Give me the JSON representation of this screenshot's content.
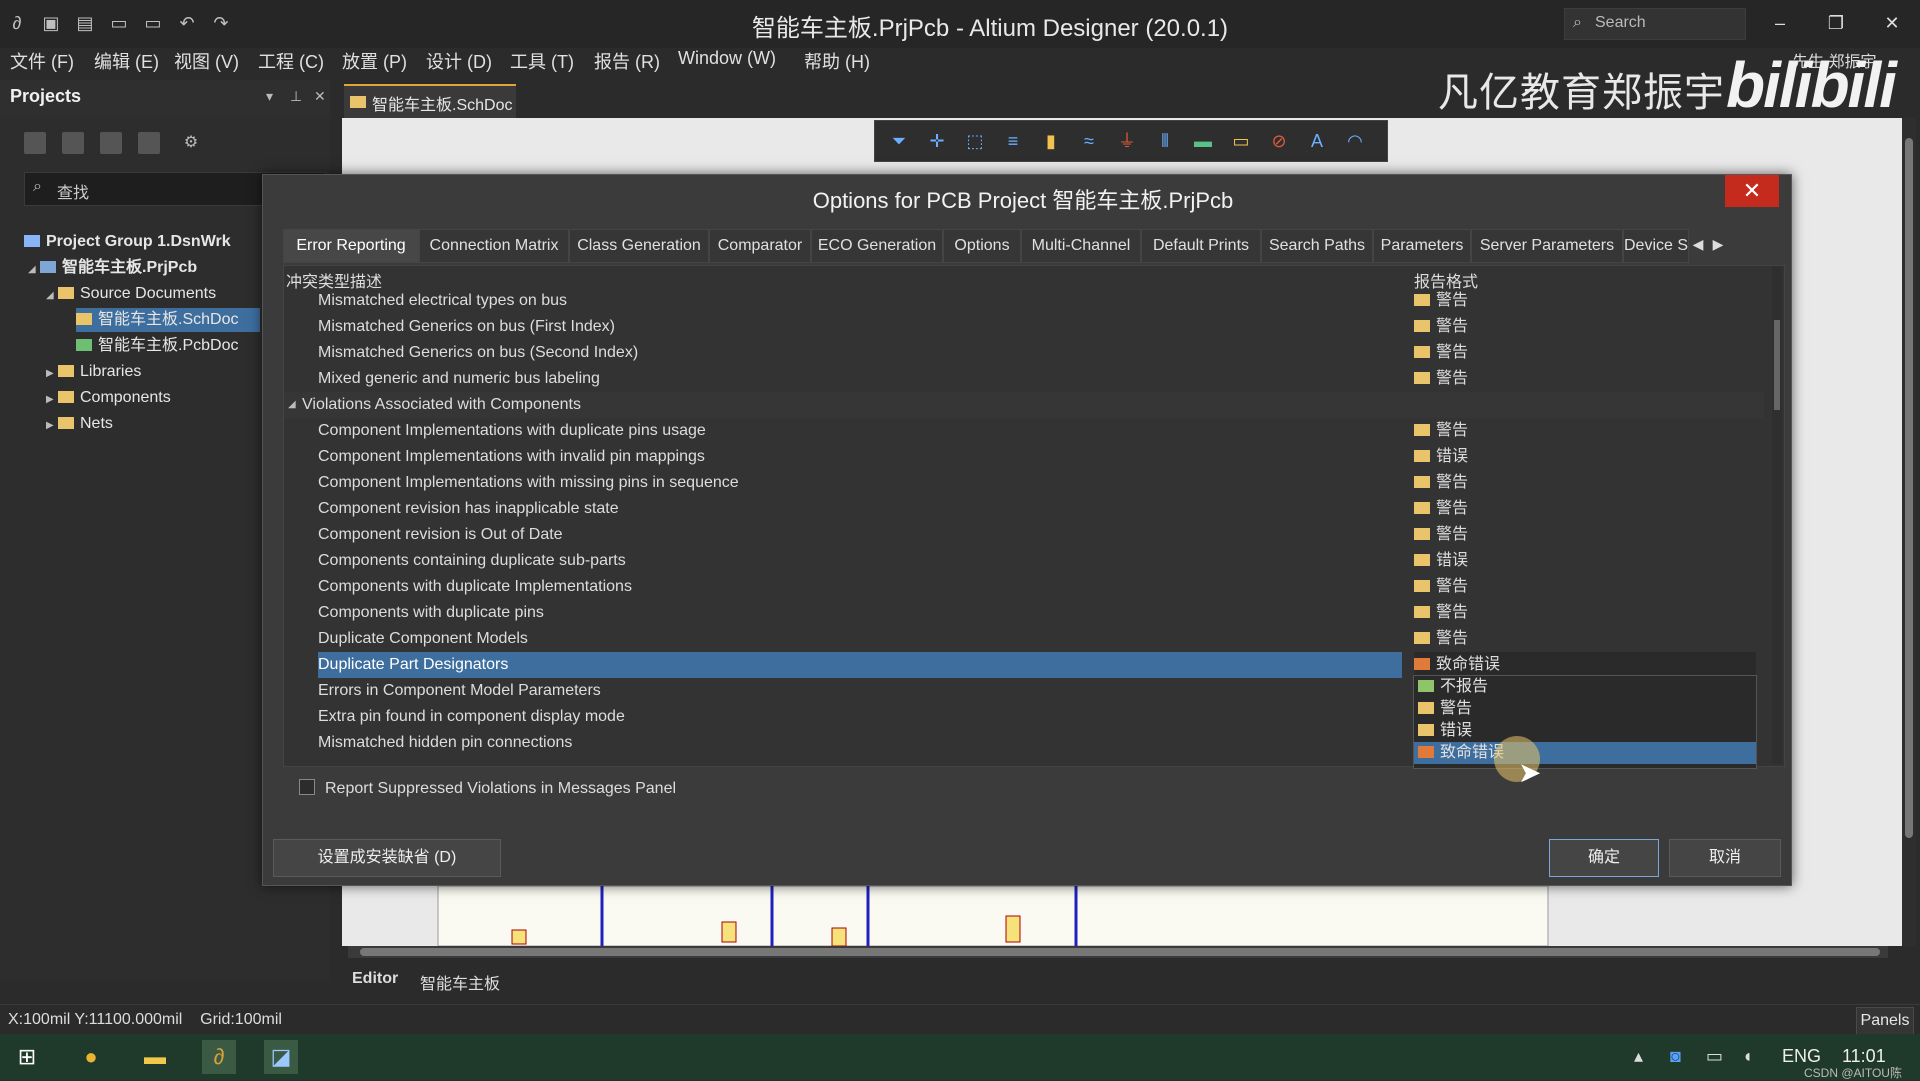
{
  "window": {
    "title": "智能车主板.PrjPcb - Altium Designer (20.0.1)",
    "search_placeholder": "Search",
    "user_label": "先生 郑振宇"
  },
  "menu": [
    "文件 (F)",
    "编辑 (E)",
    "视图 (V)",
    "工程 (C)",
    "放置 (P)",
    "设计 (D)",
    "工具 (T)",
    "报告 (R)",
    "Window (W)",
    "帮助 (H)"
  ],
  "branding": {
    "text": "凡亿教育郑振宇",
    "bili": "bilibili"
  },
  "projects": {
    "title": "Projects",
    "search_placeholder": "查找",
    "tree": [
      {
        "label": "Project Group 1.DsnWrk"
      },
      {
        "label": "智能车主板.PrjPcb"
      },
      {
        "label": "Source Documents"
      },
      {
        "label": "智能车主板.SchDoc"
      },
      {
        "label": "智能车主板.PcbDoc"
      },
      {
        "label": "Libraries"
      },
      {
        "label": "Components"
      },
      {
        "label": "Nets"
      }
    ]
  },
  "doc_tab": "智能车主板.SchDoc",
  "dialog": {
    "title": "Options for PCB Project 智能车主板.PrjPcb",
    "tabs": [
      "Error Reporting",
      "Connection Matrix",
      "Class Generation",
      "Comparator",
      "ECO Generation",
      "Options",
      "Multi-Channel",
      "Default Prints",
      "Search Paths",
      "Parameters",
      "Server Parameters",
      "Device S"
    ],
    "col_desc": "冲突类型描述",
    "col_report": "报告格式",
    "rows": [
      {
        "desc": "Mismatched electrical types on bus",
        "report": "警告"
      },
      {
        "desc": "Mismatched Generics on bus (First Index)",
        "report": "警告"
      },
      {
        "desc": "Mismatched Generics on bus (Second Index)",
        "report": "警告"
      },
      {
        "desc": "Mixed generic and numeric bus labeling",
        "report": "警告"
      },
      {
        "desc": "Violations Associated with Components",
        "report": ""
      },
      {
        "desc": "Component Implementations with duplicate pins usage",
        "report": "警告"
      },
      {
        "desc": "Component Implementations with invalid pin mappings",
        "report": "错误"
      },
      {
        "desc": "Component Implementations with missing pins in sequence",
        "report": "警告"
      },
      {
        "desc": "Component revision has inapplicable state",
        "report": "警告"
      },
      {
        "desc": "Component revision is Out of Date",
        "report": "警告"
      },
      {
        "desc": "Components containing duplicate sub-parts",
        "report": "错误"
      },
      {
        "desc": "Components with duplicate Implementations",
        "report": "警告"
      },
      {
        "desc": "Components with duplicate pins",
        "report": "警告"
      },
      {
        "desc": "Duplicate Component Models",
        "report": "警告"
      },
      {
        "desc": "Duplicate Part Designators",
        "report": "致命错误"
      },
      {
        "desc": "Errors in Component Model Parameters",
        "report": ""
      },
      {
        "desc": "Extra pin found in component display mode",
        "report": ""
      },
      {
        "desc": "Mismatched hidden pin connections",
        "report": ""
      }
    ],
    "dropdown": [
      "不报告",
      "警告",
      "错误",
      "致命错误"
    ],
    "suppress_label": "Report Suppressed Violations in Messages Panel",
    "default_button": "设置成安装缺省 (D)",
    "ok": "确定",
    "cancel": "取消"
  },
  "bottom_tabs": [
    "Editor",
    "智能车主板"
  ],
  "status": {
    "coords": "X:100mil Y:11100.000mil",
    "grid": "Grid:100mil",
    "panels": "Panels"
  },
  "taskbar": {
    "lang": "ENG",
    "time": "11:01",
    "watermark": "CSDN @AITOU陈"
  }
}
